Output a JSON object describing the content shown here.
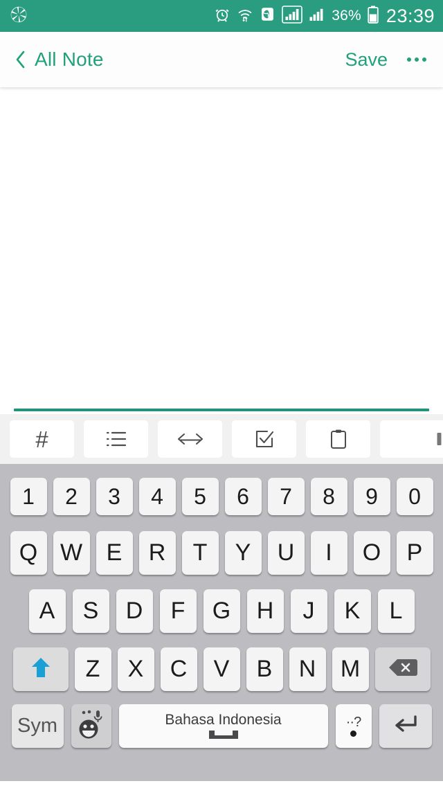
{
  "status_bar": {
    "background_color": "#2a9d80",
    "left_icons": [
      "camera-aperture-icon"
    ],
    "right_icons": [
      "alarm-clock-icon",
      "wifi-icon",
      "sim-globe-icon",
      "signal-boxed-icon",
      "signal-icon"
    ],
    "battery_percent": "36%",
    "clock": "23:39"
  },
  "app_bar": {
    "back_label": "All Note",
    "save_label": "Save",
    "overflow_label": "",
    "accent_color": "#21a179",
    "background_color": "#fdfdfd"
  },
  "note": {
    "value": "",
    "placeholder": "",
    "underline_color": "#21927c"
  },
  "format_toolbar": {
    "background_color": "#f1f1f1",
    "items": [
      {
        "name": "heading-hash-icon",
        "label": "#"
      },
      {
        "name": "bullet-list-icon",
        "label": ""
      },
      {
        "name": "code-brackets-icon",
        "label": ""
      },
      {
        "name": "checkbox-task-icon",
        "label": ""
      },
      {
        "name": "clipboard-icon",
        "label": ""
      },
      {
        "name": "partial-icon",
        "label": ""
      }
    ]
  },
  "keyboard": {
    "background_color": "#bcbcc1",
    "key_color": "#f4f4f4",
    "shift_active": true,
    "shift_arrow_color": "#1ba0d6",
    "number_row": [
      "1",
      "2",
      "3",
      "4",
      "5",
      "6",
      "7",
      "8",
      "9",
      "0"
    ],
    "row_top": [
      "Q",
      "W",
      "E",
      "R",
      "T",
      "Y",
      "U",
      "I",
      "O",
      "P"
    ],
    "row_home": [
      "A",
      "S",
      "D",
      "F",
      "G",
      "H",
      "J",
      "K",
      "L"
    ],
    "row_bottom": [
      "Z",
      "X",
      "C",
      "V",
      "B",
      "N",
      "M"
    ],
    "shift_key": "",
    "backspace_key": "",
    "sym_key": "Sym",
    "emoji_key": "",
    "space_key": "Bahasa Indonesia",
    "period_key_top": "··?",
    "period_key": ".",
    "enter_key": ""
  }
}
